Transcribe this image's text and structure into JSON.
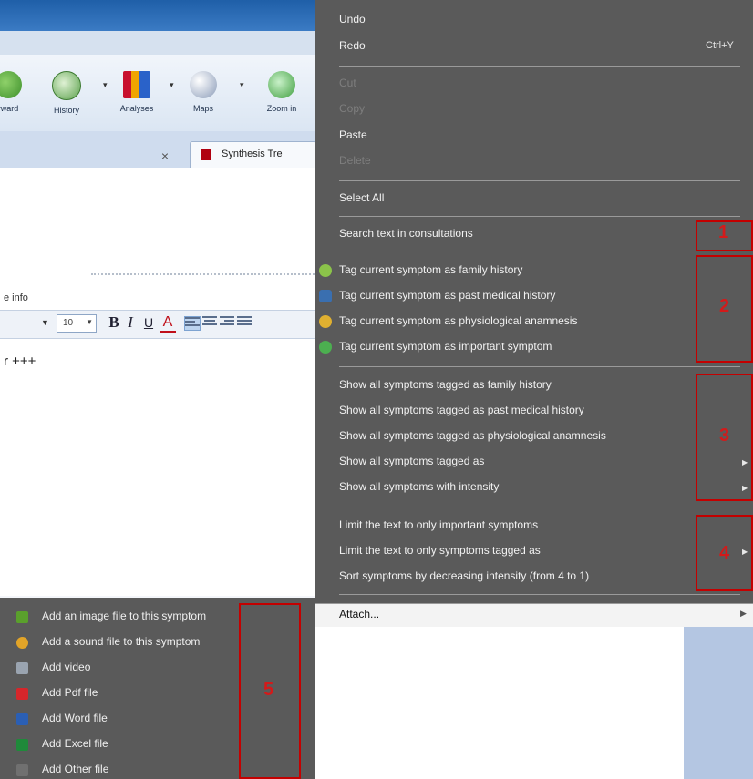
{
  "toolbar": {
    "buttons": [
      {
        "label": "rward"
      },
      {
        "label": "History"
      },
      {
        "label": "Analyses"
      },
      {
        "label": "Maps"
      },
      {
        "label": "Zoom in"
      }
    ]
  },
  "tabs": {
    "close_glyph": "×",
    "synthesis_label": "Synthesis Tre"
  },
  "editor": {
    "info_label": "e info",
    "font_size": "10",
    "bold": "B",
    "italic": "I",
    "underline": "U",
    "font_color": "A",
    "text": "r +++"
  },
  "menu": {
    "undo": "Undo",
    "redo": "Redo",
    "redo_shortcut": "Ctrl+Y",
    "cut": "Cut",
    "copy": "Copy",
    "paste": "Paste",
    "delete": "Delete",
    "select_all": "Select All",
    "search_text": "Search text in consultations",
    "tag_items": [
      "Tag current symptom as family history",
      "Tag current symptom as past medical history",
      "Tag current symptom as physiological anamnesis",
      "Tag current symptom as important symptom"
    ],
    "show_items": [
      "Show all symptoms tagged as family history",
      "Show all symptoms tagged as past medical history",
      "Show all symptoms tagged as physiological anamnesis",
      "Show all symptoms tagged as",
      "Show all symptoms with intensity"
    ],
    "limit_items": [
      "Limit the text to only important symptoms",
      "Limit the text to only symptoms tagged as",
      "Sort symptoms by decreasing intensity (from 4 to 1)"
    ],
    "attach": "Attach..."
  },
  "submenu": {
    "items": [
      "Add an image file to this symptom",
      "Add a sound file to this symptom",
      "Add video",
      "Add Pdf file",
      "Add Word file",
      "Add Excel file",
      "Add Other file"
    ]
  },
  "annotations": [
    "1",
    "2",
    "3",
    "4",
    "5"
  ],
  "colors": {
    "menu_bg": "#5a5a5a",
    "annotation_red": "#c40000"
  }
}
